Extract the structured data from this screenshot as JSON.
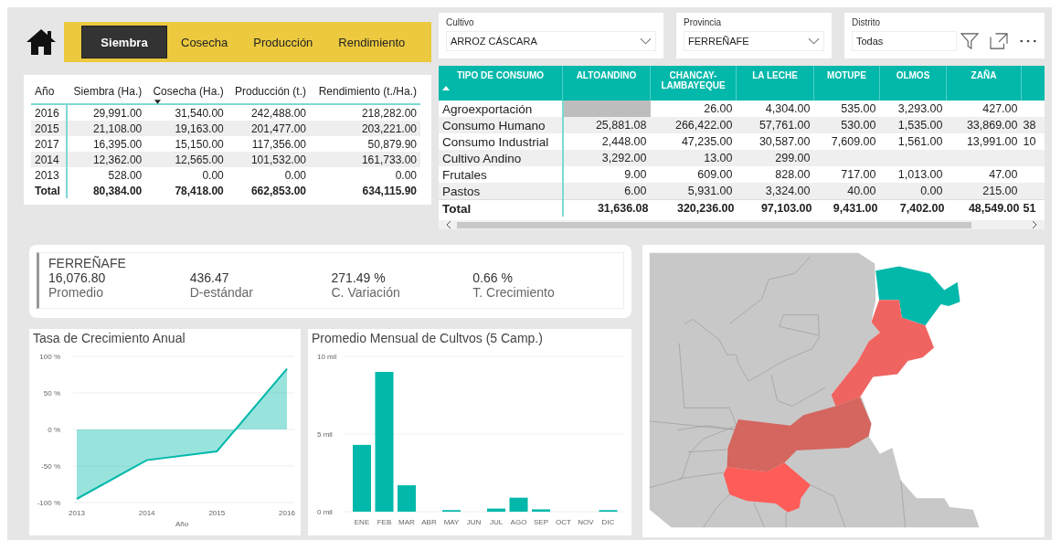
{
  "nav": {
    "tabs": [
      {
        "label": "Siembra",
        "selected": true
      },
      {
        "label": "Cosecha",
        "selected": false
      },
      {
        "label": "Producción",
        "selected": false
      },
      {
        "label": "Rendimiento",
        "selected": false
      }
    ]
  },
  "summary_table": {
    "columns": [
      {
        "label": "Año",
        "sorted": false
      },
      {
        "label": "Siembra (Ha.)",
        "sorted": false
      },
      {
        "label": "Cosecha (Ha.)",
        "sorted": true,
        "descending": true
      },
      {
        "label": "Producción (t.)",
        "sorted": false
      },
      {
        "label": "Rendimiento (t./Ha.)",
        "sorted": false
      }
    ],
    "rows": [
      [
        "2016",
        "29,991.00",
        "31,540.00",
        "242,488.00",
        "218,282.00"
      ],
      [
        "2015",
        "21,108.00",
        "19,163.00",
        "201,477.00",
        "203,221.00"
      ],
      [
        "2017",
        "16,395.00",
        "15,150.00",
        "117,356.00",
        "50,879.90"
      ],
      [
        "2014",
        "12,362.00",
        "12,565.00",
        "101,532.00",
        "161,733.00"
      ],
      [
        "2013",
        "528.00",
        "0.00",
        "0.00",
        "0.00"
      ]
    ],
    "total": [
      "Total",
      "80,384.00",
      "78,418.00",
      "662,853.00",
      "634,115.90"
    ]
  },
  "slicers": [
    {
      "label": "Cultivo",
      "value": "ARROZ CÁSCARA",
      "dropdown": true
    },
    {
      "label": "Provincia",
      "value": "FERREÑAFE",
      "dropdown": true
    },
    {
      "label": "Distrito",
      "value": "Todas",
      "dropdown": false
    }
  ],
  "matrix": {
    "columns": [
      {
        "label": "TIPO DE CONSUMO",
        "sorted": true,
        "descending": false
      },
      {
        "label": "ALTOANDINO",
        "sorted": false
      },
      {
        "label": "CHANCAY-LAMBAYEQUE",
        "sorted": false
      },
      {
        "label": "LA LECHE",
        "sorted": false
      },
      {
        "label": "MOTUPE",
        "sorted": false
      },
      {
        "label": "OLMOS",
        "sorted": false
      },
      {
        "label": "ZAÑA",
        "sorted": false
      }
    ],
    "rows": [
      [
        "Agroexportación",
        {
          "shaded": true
        },
        "26.00",
        "4,304.00",
        "535.00",
        "3,293.00",
        "427.00",
        null
      ],
      [
        "Consumo Humano",
        "25,881.08",
        "266,422.00",
        "57,761.00",
        "530.00",
        "1,535.00",
        "33,869.00",
        "38"
      ],
      [
        "Consumo Industrial",
        "2,448.00",
        "47,235.00",
        "30,587.00",
        "7,609.00",
        "1,561.00",
        "13,991.00",
        "10"
      ],
      [
        "Cultivo Andino",
        "3,292.00",
        "13.00",
        "299.00",
        null,
        null,
        null,
        null
      ],
      [
        "Frutales",
        "9.00",
        "609.00",
        "828.00",
        "717.00",
        "1,013.00",
        "47.00",
        null
      ],
      [
        "Pastos",
        "6.00",
        "5,931.00",
        "3,324.00",
        "40.00",
        "0.00",
        "215.00",
        null
      ]
    ],
    "total": [
      "Total",
      "31,636.08",
      "320,236.00",
      "97,103.00",
      "9,431.00",
      "7,402.00",
      "48,549.00",
      "51"
    ]
  },
  "kpi": {
    "title": "FERREÑAFE",
    "stats": [
      {
        "value": "16,076.80",
        "label": "Promedio"
      },
      {
        "value": "436.47",
        "label": "D-estándar"
      },
      {
        "value": "271.49 %",
        "label": "C. Variación"
      },
      {
        "value": "0.66 %",
        "label": "T. Crecimiento"
      }
    ]
  },
  "growth_chart": {
    "title": "Tasa de Crecimiento Anual",
    "chart_data": {
      "type": "area",
      "xlabel": "Año",
      "x": [
        "2013",
        "2014",
        "2015",
        "2016"
      ],
      "series": [
        {
          "color": "#01b8aa",
          "values": [
            -95,
            -42,
            -30,
            83
          ]
        }
      ],
      "grid": true,
      "ylim": [
        -100,
        100
      ],
      "yticks": [
        {
          "value": 100,
          "label": "100 %"
        },
        {
          "value": 50,
          "label": "50 %"
        },
        {
          "value": 0,
          "label": "0 %"
        },
        {
          "value": -50,
          "label": "-50 %"
        },
        {
          "value": -100,
          "label": "-100 %"
        }
      ]
    }
  },
  "monthly_chart": {
    "title": "Promedio Mensual de Cultvos (5 Camp.)",
    "chart_data": {
      "type": "bar",
      "categories": [
        "ENE",
        "FEB",
        "MAR",
        "ABR",
        "MAY",
        "JUN",
        "JUL",
        "AGO",
        "SEP",
        "OCT",
        "NOV",
        "DIC"
      ],
      "series": [
        {
          "color": "#01b8aa",
          "values": [
            4.3,
            9.0,
            1.7,
            0,
            0.1,
            0,
            0.2,
            0.9,
            0.15,
            0,
            0,
            0.1
          ]
        }
      ],
      "grid": true,
      "ylim": [
        0,
        10
      ],
      "yticks": [
        {
          "value": 0,
          "label": "0 mil"
        },
        {
          "value": 5,
          "label": "5 mil"
        },
        {
          "value": 10,
          "label": "10 mil"
        }
      ]
    }
  }
}
